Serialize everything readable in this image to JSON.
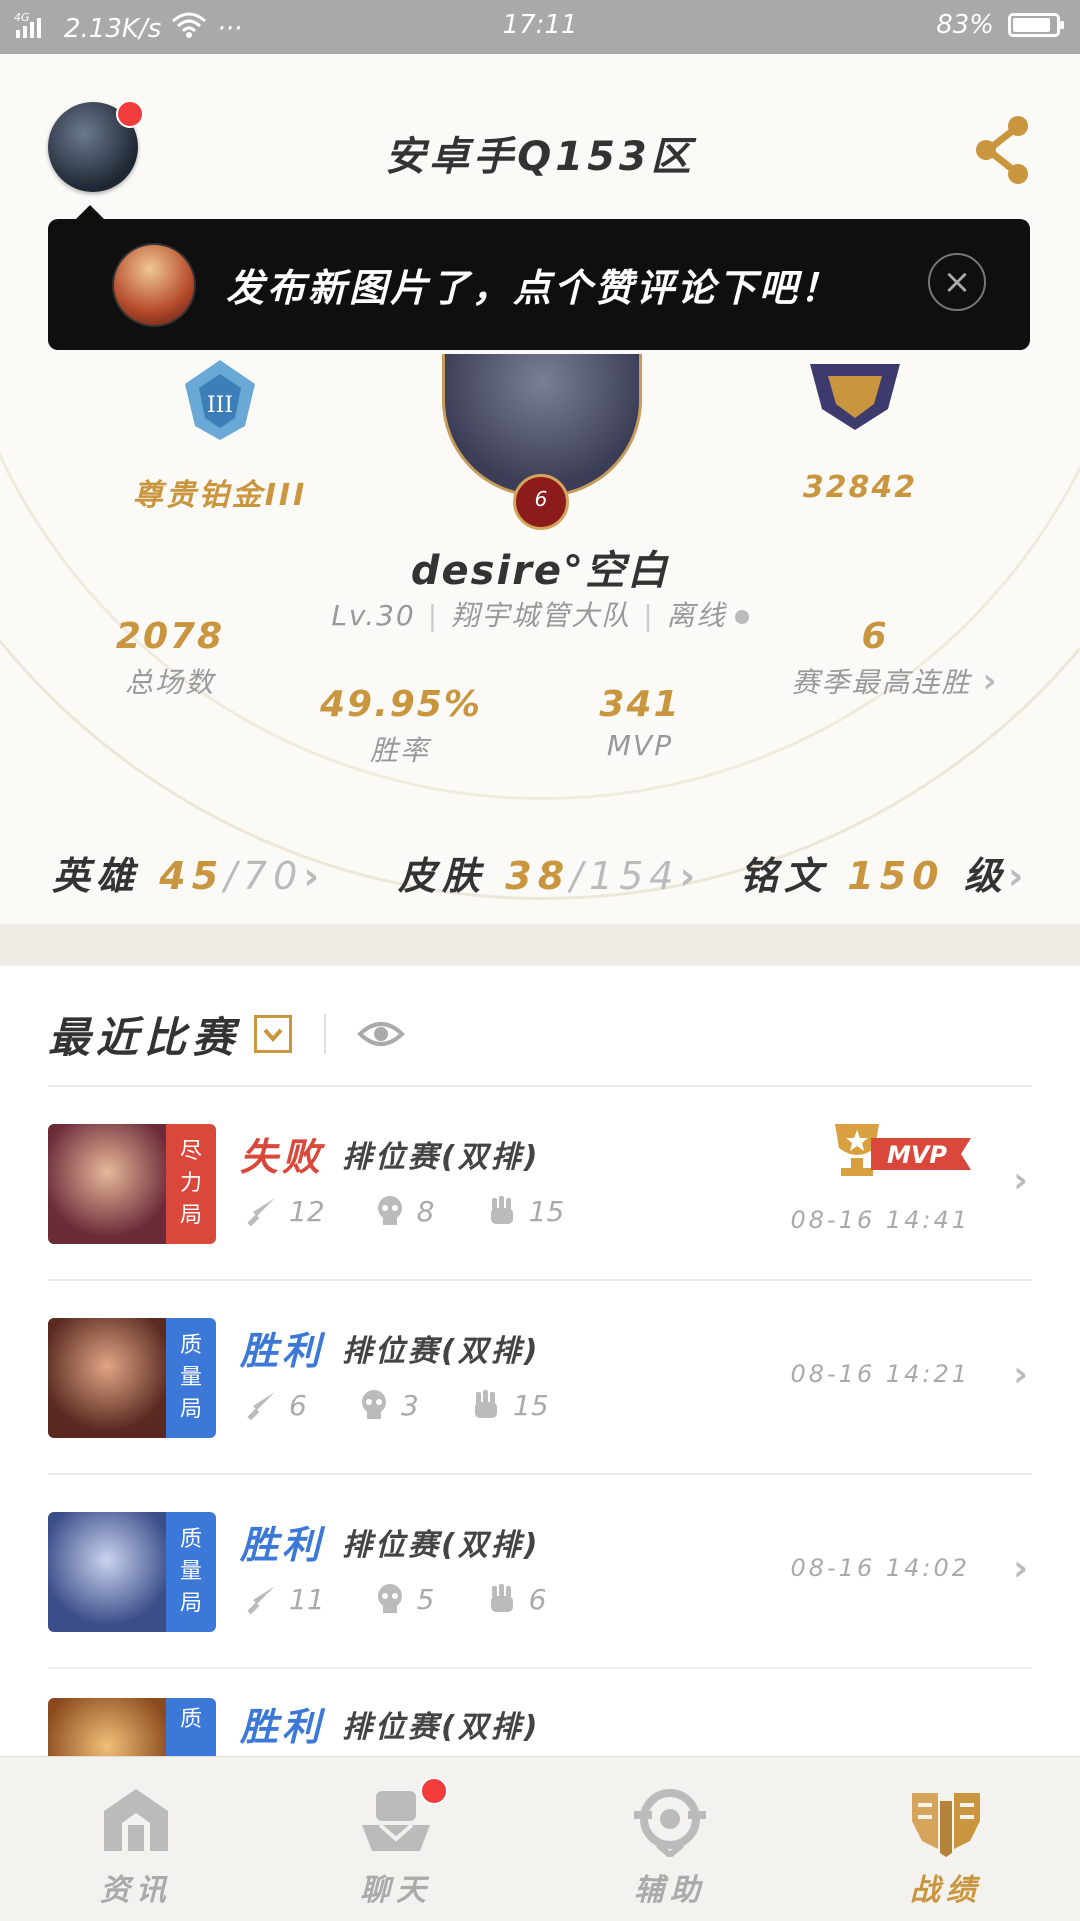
{
  "status_bar": {
    "network": "4G",
    "speed": "2.13K/s",
    "more": "···",
    "time": "17:11",
    "battery": "83%"
  },
  "header": {
    "zone_title": "安卓手Q153区"
  },
  "notification": {
    "text": "发布新图片了，点个赞评论下吧！",
    "close": "×"
  },
  "profile": {
    "rank": "尊贵铂金III",
    "score": "32842",
    "level_badge": "6",
    "name": "desire°空白",
    "level": "Lv.30",
    "team": "翔宇城管大队",
    "status": "离线"
  },
  "stats": {
    "total_games": {
      "value": "2078",
      "label": "总场数"
    },
    "win_rate": {
      "value": "49.95%",
      "label": "胜率"
    },
    "mvp": {
      "value": "341",
      "label": "MVP"
    },
    "max_streak": {
      "value": "6",
      "label": "赛季最高连胜"
    }
  },
  "collection": {
    "heroes": {
      "label": "英雄",
      "owned": "45",
      "total": "70"
    },
    "skins": {
      "label": "皮肤",
      "owned": "38",
      "total": "154"
    },
    "runes": {
      "label": "铭文",
      "value": "150",
      "unit": "级"
    }
  },
  "matches": {
    "title": "最近比赛",
    "items": [
      {
        "tag": "尽力局",
        "tag_color": "#d9483b",
        "result": "失败",
        "result_color": "#d9483b",
        "mode": "排位赛(双排)",
        "kills": "12",
        "deaths": "8",
        "assists": "15",
        "time": "08-16 14:41",
        "mvp": "MVP"
      },
      {
        "tag": "质量局",
        "tag_color": "#3b78d8",
        "result": "胜利",
        "result_color": "#3b78d8",
        "mode": "排位赛(双排)",
        "kills": "6",
        "deaths": "3",
        "assists": "15",
        "time": "08-16 14:21"
      },
      {
        "tag": "质量局",
        "tag_color": "#3b78d8",
        "result": "胜利",
        "result_color": "#3b78d8",
        "mode": "排位赛(双排)",
        "kills": "11",
        "deaths": "5",
        "assists": "6",
        "time": "08-16 14:02"
      },
      {
        "tag": "质",
        "tag_color": "#3b78d8",
        "result": "胜利",
        "result_color": "#3b78d8",
        "mode": "排位赛(双排)"
      }
    ]
  },
  "nav": {
    "items": [
      {
        "label": "资讯",
        "icon": "news-icon"
      },
      {
        "label": "聊天",
        "icon": "chat-icon"
      },
      {
        "label": "辅助",
        "icon": "assist-icon"
      },
      {
        "label": "战绩",
        "icon": "record-icon"
      }
    ],
    "active": "战绩"
  },
  "colors": {
    "gold": "#c9963f",
    "loss": "#d9483b",
    "win": "#3b78d8",
    "notification_bg": "#0f0f0f"
  }
}
